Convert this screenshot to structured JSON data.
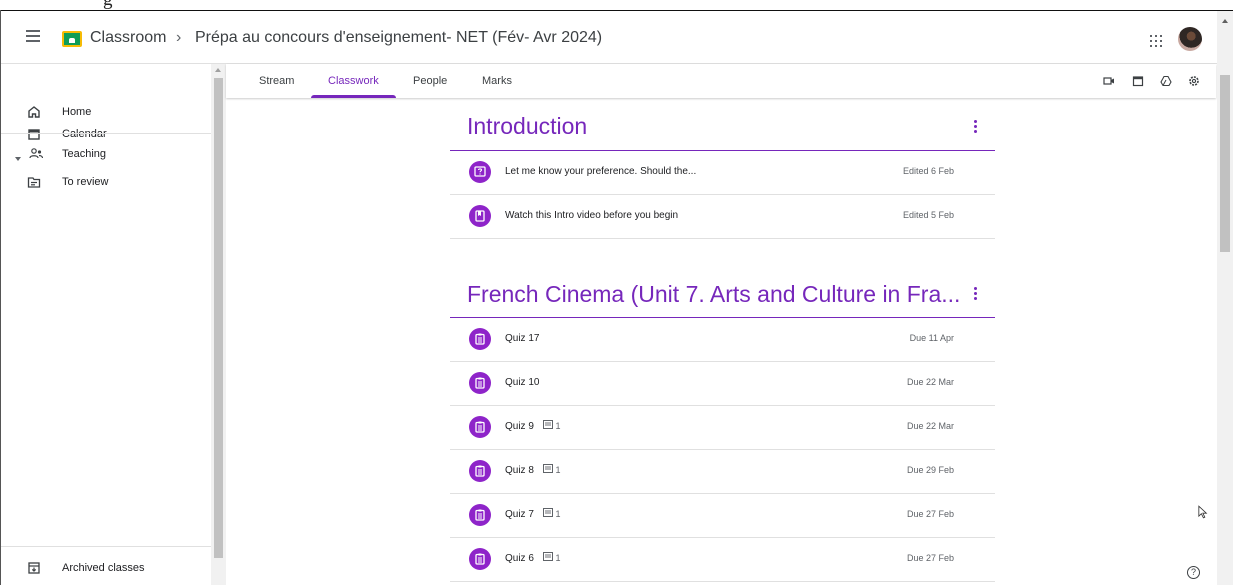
{
  "top_clip_text": "g",
  "header": {
    "app_name": "Classroom",
    "separator": "›",
    "class_title": "Prépa au concours d'enseignement- NET (Fév- Avr 2024)"
  },
  "sidebar": {
    "items": [
      {
        "label": "Home",
        "icon": "home-icon"
      },
      {
        "label": "Calendar",
        "icon": "calendar-icon"
      },
      {
        "label": "Teaching",
        "icon": "people-icon"
      },
      {
        "label": "To review",
        "icon": "review-icon"
      }
    ],
    "archived_label": "Archived classes"
  },
  "tabs": [
    {
      "label": "Stream",
      "active": false
    },
    {
      "label": "Classwork",
      "active": true
    },
    {
      "label": "People",
      "active": false
    },
    {
      "label": "Marks",
      "active": false
    }
  ],
  "toolbar_icons": [
    "video-icon",
    "calendar-icon",
    "drive-icon",
    "settings-icon"
  ],
  "topics": [
    {
      "title": "Introduction",
      "items": [
        {
          "title": "Let me know your preference. Should the...",
          "date": "Edited 6 Feb",
          "icon": "question-icon",
          "comments": ""
        },
        {
          "title": "Watch this Intro video before you begin",
          "date": "Edited 5 Feb",
          "icon": "material-icon",
          "comments": ""
        }
      ]
    },
    {
      "title": "French Cinema (Unit 7. Arts and Culture in Fra...",
      "items": [
        {
          "title": "Quiz 17",
          "date": "Due 11 Apr",
          "icon": "assignment-icon",
          "comments": ""
        },
        {
          "title": "Quiz 10",
          "date": "Due 22 Mar",
          "icon": "assignment-icon",
          "comments": ""
        },
        {
          "title": "Quiz 9",
          "date": "Due 22 Mar",
          "icon": "assignment-icon",
          "comments": "1"
        },
        {
          "title": "Quiz 8",
          "date": "Due 29 Feb",
          "icon": "assignment-icon",
          "comments": "1"
        },
        {
          "title": "Quiz 7",
          "date": "Due 27 Feb",
          "icon": "assignment-icon",
          "comments": "1"
        },
        {
          "title": "Quiz 6",
          "date": "Due 27 Feb",
          "icon": "assignment-icon",
          "comments": "1"
        }
      ]
    }
  ],
  "help_label": "?",
  "colors": {
    "accent": "#7627bb",
    "badge": "#8e24c9",
    "logo_green": "#0f9d58",
    "logo_yellow": "#f6bb05"
  }
}
